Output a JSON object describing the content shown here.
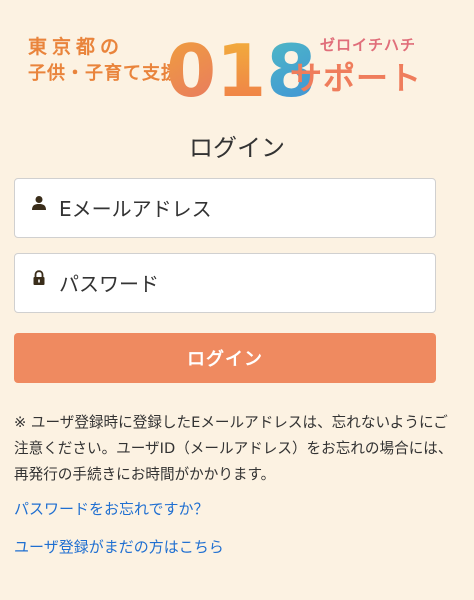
{
  "logo": {
    "line1": "東京都の",
    "line2": "子供・子育て支援",
    "number": "018",
    "kana_small": "ゼロイチハチ",
    "support": "サポート"
  },
  "page": {
    "title": "ログイン"
  },
  "form": {
    "email_placeholder": "Eメールアドレス",
    "password_placeholder": "パスワード",
    "login_label": "ログイン"
  },
  "notice": {
    "text": "※ ユーザ登録時に登録したEメールアドレスは、忘れないようにご注意ください。ユーザID（メールアドレス）をお忘れの場合には、再発行の手続きにお時間がかかります。"
  },
  "links": {
    "forgot_password": "パスワードをお忘れですか？",
    "register": "ユーザ登録がまだの方はこちら"
  },
  "colors": {
    "background": "#fcf2e2",
    "button": "#ef8a60",
    "link": "#1f6fd1",
    "logo_orange": "#e9843c"
  },
  "icons": {
    "email": "user-icon",
    "password": "lock-icon"
  }
}
